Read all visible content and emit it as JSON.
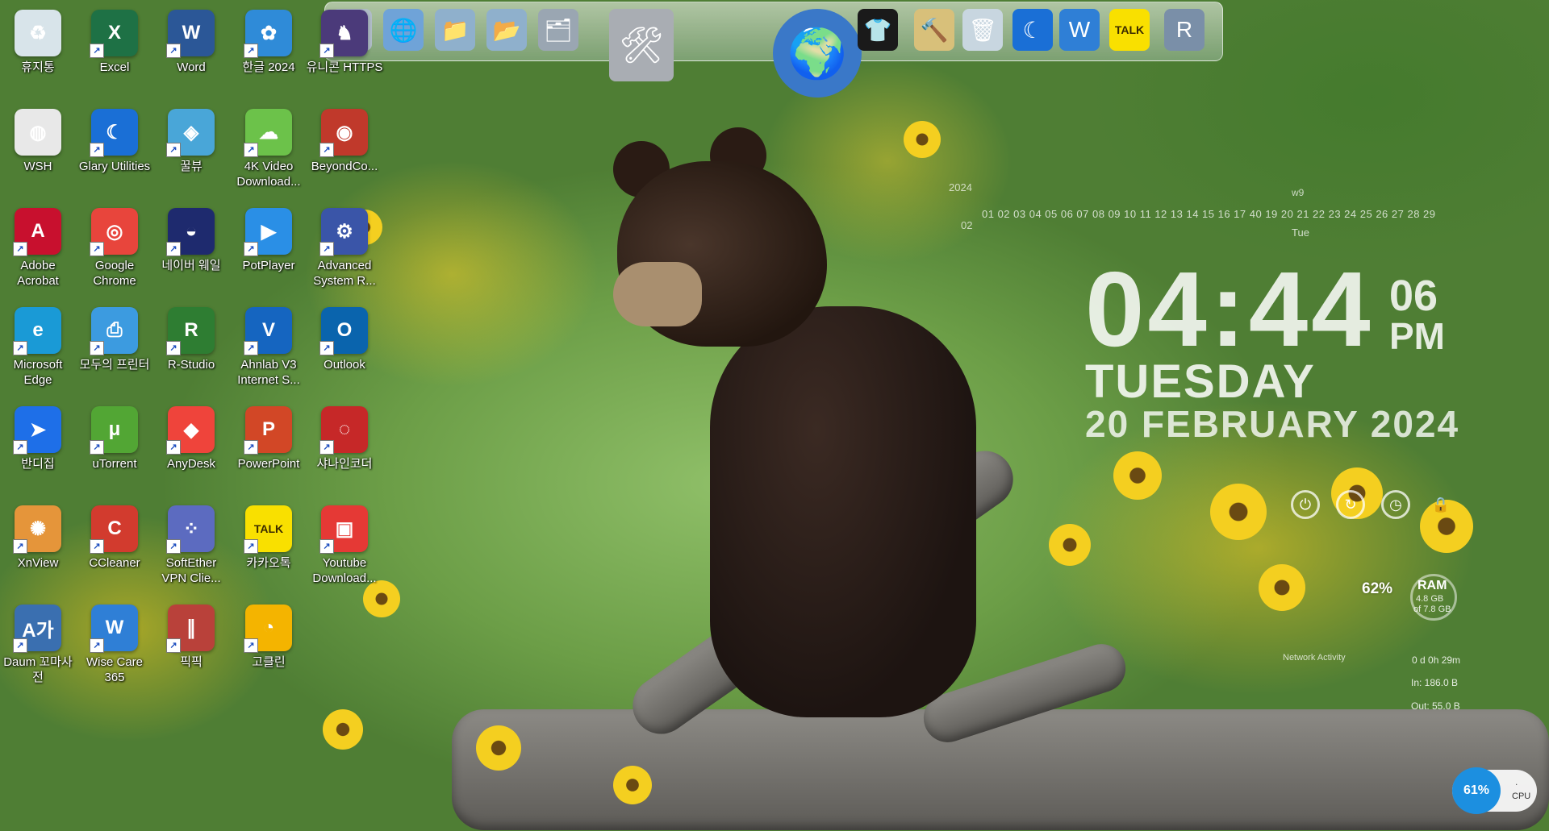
{
  "desktop_icons": [
    {
      "label": "휴지통",
      "icon": "recycle-bin-icon",
      "color": "#d8e4ea",
      "glyph": "♻",
      "shortcut": false
    },
    {
      "label": "Excel",
      "icon": "excel-icon",
      "color": "#1e7145",
      "glyph": "X",
      "shortcut": true
    },
    {
      "label": "Word",
      "icon": "word-icon",
      "color": "#2b5797",
      "glyph": "W",
      "shortcut": true
    },
    {
      "label": "한글 2024",
      "icon": "hangul-icon",
      "color": "#2f8bd8",
      "glyph": "✿",
      "shortcut": true
    },
    {
      "label": "유니콘 HTTPS",
      "icon": "unicorn-https-icon",
      "color": "#4b3a7a",
      "glyph": "♞",
      "shortcut": true
    },
    {
      "label": "WSH",
      "icon": "wsh-icon",
      "color": "#e8e8e8",
      "glyph": "◍",
      "shortcut": false
    },
    {
      "label": "Glary Utilities",
      "icon": "glary-utilities-icon",
      "color": "#1a6fd6",
      "glyph": "☾",
      "shortcut": true
    },
    {
      "label": "꿀뷰",
      "icon": "honeyview-icon",
      "color": "#49a6d8",
      "glyph": "◈",
      "shortcut": true
    },
    {
      "label": "4K Video Download...",
      "icon": "4k-video-downloader-icon",
      "color": "#6cc24a",
      "glyph": "☁",
      "shortcut": true
    },
    {
      "label": "BeyondCo...",
      "icon": "beyond-compare-icon",
      "color": "#c0392b",
      "glyph": "◉",
      "shortcut": true
    },
    {
      "label": "Adobe Acrobat",
      "icon": "adobe-acrobat-icon",
      "color": "#c8102e",
      "glyph": "A",
      "shortcut": true
    },
    {
      "label": "Google Chrome",
      "icon": "google-chrome-icon",
      "color": "#e8453c",
      "glyph": "◎",
      "shortcut": true
    },
    {
      "label": "네이버 웨일",
      "icon": "naver-whale-icon",
      "color": "#1e2a6e",
      "glyph": "◒",
      "shortcut": true
    },
    {
      "label": "PotPlayer",
      "icon": "potplayer-icon",
      "color": "#2a8fe6",
      "glyph": "▶",
      "shortcut": true
    },
    {
      "label": "Advanced System R...",
      "icon": "advanced-system-repair-icon",
      "color": "#3a55a8",
      "glyph": "⚙",
      "shortcut": true
    },
    {
      "label": "Microsoft Edge",
      "icon": "microsoft-edge-icon",
      "color": "#1a9ad6",
      "glyph": "e",
      "shortcut": true
    },
    {
      "label": "모두의 프린터",
      "icon": "printer-icon",
      "color": "#3c9be0",
      "glyph": "⎙",
      "shortcut": true
    },
    {
      "label": "R-Studio",
      "icon": "r-studio-icon",
      "color": "#2e7d32",
      "glyph": "R",
      "shortcut": true
    },
    {
      "label": "Ahnlab V3 Internet S...",
      "icon": "ahnlab-v3-icon",
      "color": "#1565c0",
      "glyph": "V",
      "shortcut": true
    },
    {
      "label": "Outlook",
      "icon": "outlook-icon",
      "color": "#0a64ad",
      "glyph": "O",
      "shortcut": true
    },
    {
      "label": "반디집",
      "icon": "bandizip-icon",
      "color": "#1e6fe8",
      "glyph": "➤",
      "shortcut": true
    },
    {
      "label": "uTorrent",
      "icon": "utorrent-icon",
      "color": "#52a634",
      "glyph": "μ",
      "shortcut": true
    },
    {
      "label": "AnyDesk",
      "icon": "anydesk-icon",
      "color": "#ef443b",
      "glyph": "◆",
      "shortcut": true
    },
    {
      "label": "PowerPoint",
      "icon": "powerpoint-icon",
      "color": "#d24726",
      "glyph": "P",
      "shortcut": true
    },
    {
      "label": "샤나인코더",
      "icon": "shana-encoder-icon",
      "color": "#c62828",
      "glyph": "◌",
      "shortcut": true
    },
    {
      "label": "XnView",
      "icon": "xnview-icon",
      "color": "#e5953a",
      "glyph": "✺",
      "shortcut": true
    },
    {
      "label": "CCleaner",
      "icon": "ccleaner-icon",
      "color": "#d23b2e",
      "glyph": "C",
      "shortcut": true
    },
    {
      "label": "SoftEther VPN Clie...",
      "icon": "softether-vpn-icon",
      "color": "#5c6bc0",
      "glyph": "⁘",
      "shortcut": true
    },
    {
      "label": "카카오톡",
      "icon": "kakaotalk-icon",
      "color": "#f9e000",
      "glyph": "TALK",
      "shortcut": true
    },
    {
      "label": "Youtube Download...",
      "icon": "youtube-downloader-icon",
      "color": "#e53935",
      "glyph": "▣",
      "shortcut": true
    },
    {
      "label": "Daum 꼬마사전",
      "icon": "daum-dictionary-icon",
      "color": "#3a6fb0",
      "glyph": "A가",
      "shortcut": true
    },
    {
      "label": "Wise Care 365",
      "icon": "wise-care-365-icon",
      "color": "#2f7fd6",
      "glyph": "W",
      "shortcut": true
    },
    {
      "label": "픽픽",
      "icon": "picpick-icon",
      "color": "#b9413a",
      "glyph": "∥",
      "shortcut": true
    },
    {
      "label": "고클린",
      "icon": "goclean-icon",
      "color": "#f4b400",
      "glyph": "◔",
      "shortcut": true
    }
  ],
  "dock_items": [
    {
      "icon": "documents-folder-icon",
      "glyph": "🗎",
      "color": "#b0bcc8"
    },
    {
      "icon": "network-folder-icon",
      "glyph": "🌐",
      "color": "#6fa3d8"
    },
    {
      "icon": "folder-icon",
      "glyph": "📁",
      "color": "#8fb0cc"
    },
    {
      "icon": "downloads-folder-icon",
      "glyph": "📂",
      "color": "#8fb0cc"
    },
    {
      "icon": "drive-folder-icon",
      "glyph": "🗂",
      "color": "#9aa6b2"
    },
    {
      "icon": "system-tools-icon",
      "glyph": "🛠",
      "color": "#a9adb3"
    },
    {
      "icon": "web-globe-icon",
      "glyph": "🌍",
      "color": "#3a78c8"
    },
    {
      "icon": "tshirt-icon",
      "glyph": "👕",
      "color": "#1a1a1a"
    },
    {
      "icon": "hammer-tool-icon",
      "glyph": "🔨",
      "color": "#d8c07a"
    },
    {
      "icon": "recycle-bin-dock-icon",
      "glyph": "🗑",
      "color": "#c8d6e0"
    },
    {
      "icon": "glary-dock-icon",
      "glyph": "☾",
      "color": "#1a6fd6"
    },
    {
      "icon": "wise-care-dock-icon",
      "glyph": "W",
      "color": "#2f7fd6"
    },
    {
      "icon": "kakaotalk-dock-icon",
      "glyph": "TALK",
      "color": "#f9e000"
    },
    {
      "icon": "r-drive-dock-icon",
      "glyph": "R",
      "color": "#7a8fa8"
    }
  ],
  "calendar": {
    "year": "2024",
    "week": "w9",
    "month": "02",
    "days": "01 02 03 04 05 06 07 08 09 10 11 12 13 14 15 16 17 40 19 20 21 22 23 24 25 26 27 28 29",
    "day_of_week": "Tue"
  },
  "clock": {
    "time": "04:44",
    "seconds": "06",
    "ampm": "PM",
    "day": "TUESDAY",
    "date": "20 FEBRUARY 2024"
  },
  "power_controls": [
    {
      "name": "shutdown-icon",
      "glyph": "⏻"
    },
    {
      "name": "restart-icon",
      "glyph": "↻"
    },
    {
      "name": "sleep-icon",
      "glyph": "◷"
    },
    {
      "name": "lock-icon",
      "glyph": "🔒"
    }
  ],
  "ram": {
    "percent": "62%",
    "label": "RAM",
    "used": "4.8 GB",
    "total": "of 7.8 GB"
  },
  "network": {
    "title": "Network Activity",
    "uptime": "0 d 0h 29m",
    "in": "In: 186.0 B",
    "out": "Out: 55.0 B"
  },
  "cpu": {
    "percent": "61%",
    "label": "CPU",
    "mark": "."
  }
}
